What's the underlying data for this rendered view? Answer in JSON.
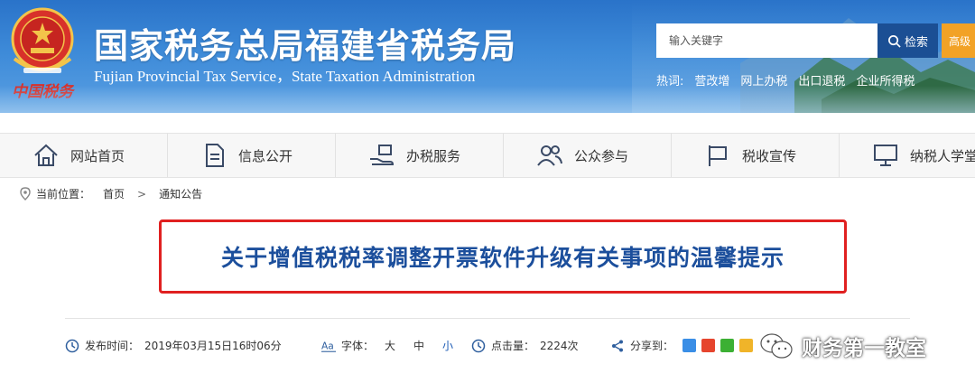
{
  "header": {
    "site_title": "国家税务总局福建省税务局",
    "site_subtitle": "Fujian Provincial Tax Service，State Taxation Administration",
    "emblem_caption": "中国税务",
    "search": {
      "placeholder": "输入关键字",
      "button_label": "检索",
      "advanced_label": "高级"
    },
    "hotwords": {
      "label": "热词:",
      "items": [
        "营改增",
        "网上办税",
        "出口退税",
        "企业所得税"
      ]
    }
  },
  "nav": {
    "items": [
      {
        "label": "网站首页",
        "icon": "home-icon"
      },
      {
        "label": "信息公开",
        "icon": "document-icon"
      },
      {
        "label": "办税服务",
        "icon": "hand-service-icon"
      },
      {
        "label": "公众参与",
        "icon": "people-icon"
      },
      {
        "label": "税收宣传",
        "icon": "flag-icon"
      },
      {
        "label": "纳税人学堂",
        "icon": "monitor-icon"
      }
    ]
  },
  "breadcrumb": {
    "label": "当前位置：",
    "items": [
      "首页",
      "通知公告"
    ],
    "separator": ">"
  },
  "article": {
    "title": "关于增值税税率调整开票软件升级有关事项的温馨提示",
    "publish_label": "发布时间：",
    "publish_time": "2019年03月15日16时06分",
    "font_label": "字体：",
    "font_sizes": [
      "大",
      "中",
      "小"
    ],
    "hits_label": "点击量：",
    "hits": "2224次",
    "share_label": "分享到："
  },
  "watermark": {
    "text": "财务第一教室"
  },
  "colors": {
    "header_blue": "#2a73c9",
    "title_blue": "#1c4f9c",
    "highlight_red": "#e02020",
    "search_button": "#1b4f94",
    "advanced_button": "#f2a226"
  }
}
